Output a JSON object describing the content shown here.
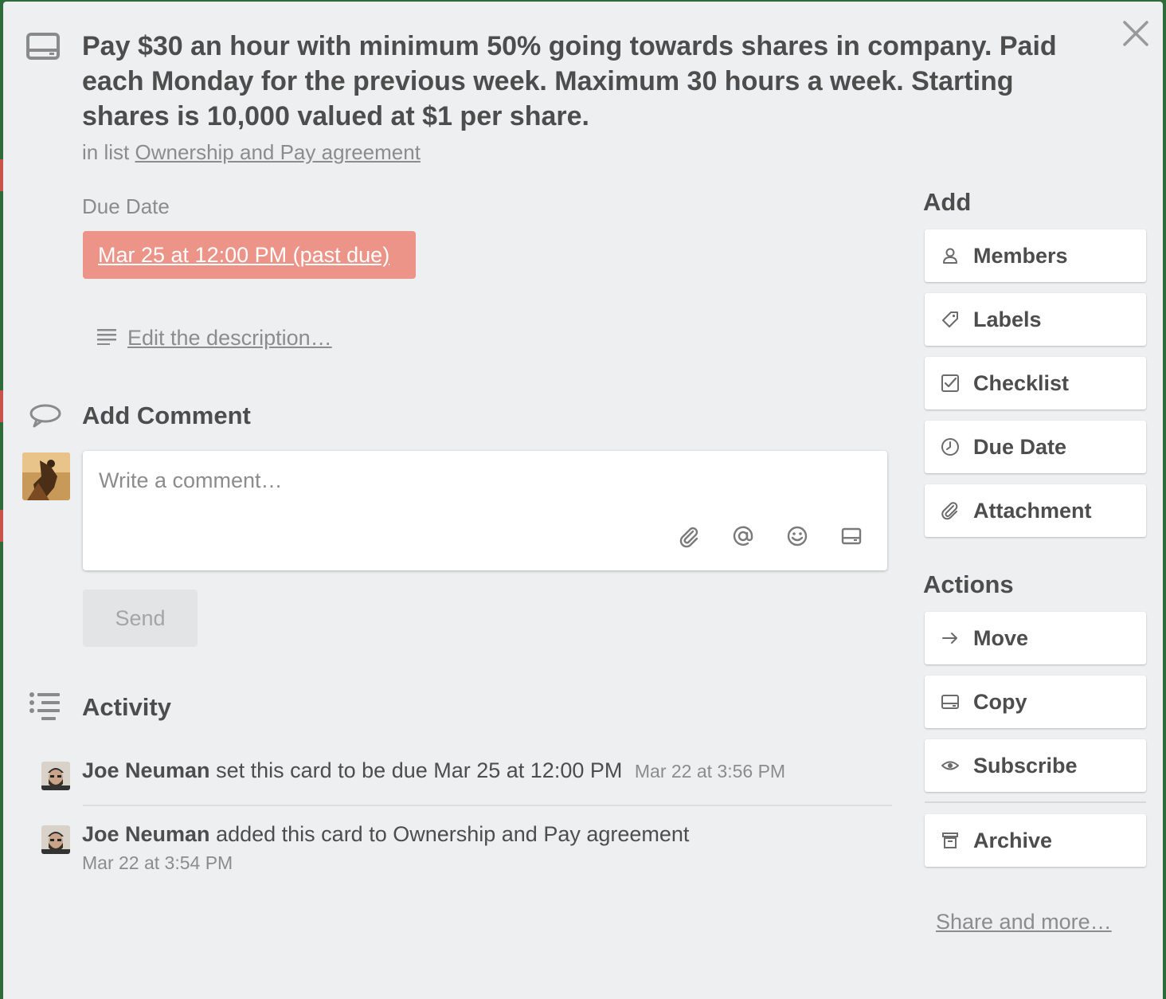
{
  "card": {
    "title": "Pay $30 an hour with minimum 50% going towards shares in company. Paid each Monday for the previous week. Maximum 30 hours a week. Starting shares is 10,000 valued at $1 per share.",
    "list_prefix": "in list",
    "list_name": "Ownership and Pay agreement"
  },
  "due": {
    "label": "Due Date",
    "value": "Mar 25 at 12:00 PM (past due)"
  },
  "description": {
    "edit_label": "Edit the description…"
  },
  "comment": {
    "heading": "Add Comment",
    "placeholder": "Write a comment…",
    "send_label": "Send",
    "toolbar_icons": [
      "attachment-icon",
      "mention-icon",
      "emoji-icon",
      "card-icon"
    ]
  },
  "activity": {
    "heading": "Activity",
    "items": [
      {
        "user": "Joe Neuman",
        "text": "set this card to be due Mar 25 at 12:00 PM",
        "time": "Mar 22 at 3:56 PM"
      },
      {
        "user": "Joe Neuman",
        "text": "added this card to Ownership and Pay agreement",
        "time": "Mar 22 at 3:54 PM"
      }
    ]
  },
  "sidebar": {
    "add_title": "Add",
    "add_buttons": [
      {
        "label": "Members",
        "icon": "person-icon"
      },
      {
        "label": "Labels",
        "icon": "tag-icon"
      },
      {
        "label": "Checklist",
        "icon": "checklist-icon"
      },
      {
        "label": "Due Date",
        "icon": "clock-icon"
      },
      {
        "label": "Attachment",
        "icon": "paperclip-icon"
      }
    ],
    "actions_title": "Actions",
    "action_buttons": [
      {
        "label": "Move",
        "icon": "arrow-right-icon"
      },
      {
        "label": "Copy",
        "icon": "card-icon"
      },
      {
        "label": "Subscribe",
        "icon": "eye-icon"
      },
      {
        "label": "Archive",
        "icon": "archive-icon"
      }
    ],
    "share_label": "Share and more…"
  },
  "colors": {
    "modal_bg": "#edeff0",
    "due_badge": "#ec9488",
    "text": "#4d4d4d",
    "muted": "#8c8c8c"
  }
}
